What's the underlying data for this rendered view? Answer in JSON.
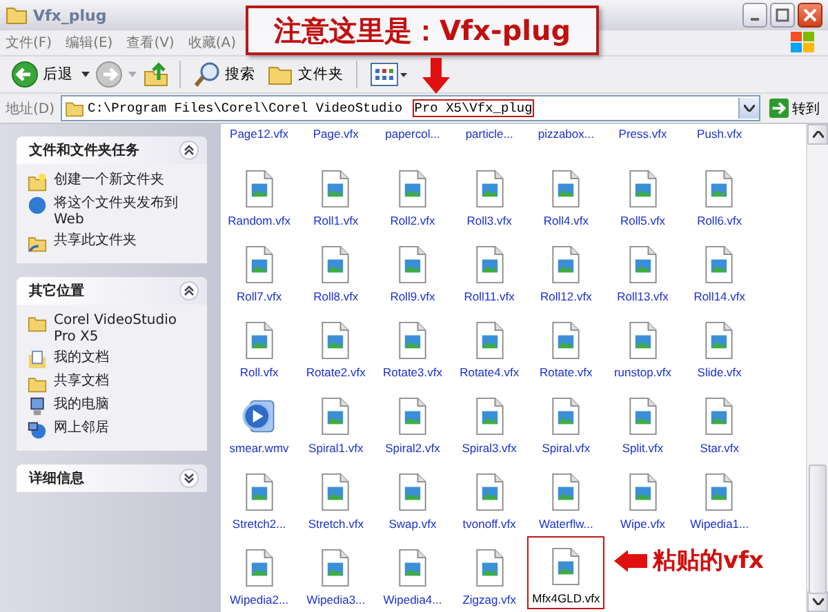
{
  "window": {
    "title": "Vfx_plug"
  },
  "menu": [
    "文件(F)",
    "编辑(E)",
    "查看(V)",
    "收藏(A)"
  ],
  "toolbar": {
    "back": "后退",
    "search": "搜索",
    "folders": "文件夹"
  },
  "address": {
    "label": "地址(D)",
    "path": "C:\\Program Files\\Corel\\Corel VideoStudio ",
    "path_marked": "Pro X5\\Vfx_plug",
    "go": "转到"
  },
  "sidebar": {
    "panels": [
      {
        "title": "文件和文件夹任务",
        "expanded": true,
        "items": [
          {
            "label": "创建一个新文件夹",
            "kind": "new-folder"
          },
          {
            "label": "将这个文件夹发布到 Web",
            "kind": "publish-web"
          },
          {
            "label": "共享此文件夹",
            "kind": "share-folder"
          }
        ]
      },
      {
        "title": "其它位置",
        "expanded": true,
        "items": [
          {
            "label": "Corel VideoStudio Pro X5",
            "kind": "folder"
          },
          {
            "label": "我的文档",
            "kind": "documents"
          },
          {
            "label": "共享文档",
            "kind": "folder"
          },
          {
            "label": "我的电脑",
            "kind": "computer"
          },
          {
            "label": "网上邻居",
            "kind": "network"
          }
        ]
      },
      {
        "title": "详细信息",
        "expanded": false
      }
    ]
  },
  "files": {
    "cut_row": [
      "Page12.vfx",
      "Page.vfx",
      "papercol...",
      "particle...",
      "pizzabox...",
      "Press.vfx",
      "Push.vfx"
    ],
    "items": [
      {
        "name": "Random.vfx",
        "kind": "vfx",
        "marked": false
      },
      {
        "name": "Roll1.vfx",
        "kind": "vfx",
        "marked": false
      },
      {
        "name": "Roll2.vfx",
        "kind": "vfx",
        "marked": false
      },
      {
        "name": "Roll3.vfx",
        "kind": "vfx",
        "marked": false
      },
      {
        "name": "Roll4.vfx",
        "kind": "vfx",
        "marked": false
      },
      {
        "name": "Roll5.vfx",
        "kind": "vfx",
        "marked": false
      },
      {
        "name": "Roll6.vfx",
        "kind": "vfx",
        "marked": false
      },
      {
        "name": "Roll7.vfx",
        "kind": "vfx",
        "marked": false
      },
      {
        "name": "Roll8.vfx",
        "kind": "vfx",
        "marked": false
      },
      {
        "name": "Roll9.vfx",
        "kind": "vfx",
        "marked": false
      },
      {
        "name": "Roll11.vfx",
        "kind": "vfx",
        "marked": false
      },
      {
        "name": "Roll12.vfx",
        "kind": "vfx",
        "marked": false
      },
      {
        "name": "Roll13.vfx",
        "kind": "vfx",
        "marked": false
      },
      {
        "name": "Roll14.vfx",
        "kind": "vfx",
        "marked": false
      },
      {
        "name": "Roll.vfx",
        "kind": "vfx",
        "marked": false
      },
      {
        "name": "Rotate2.vfx",
        "kind": "vfx",
        "marked": false
      },
      {
        "name": "Rotate3.vfx",
        "kind": "vfx",
        "marked": false
      },
      {
        "name": "Rotate4.vfx",
        "kind": "vfx",
        "marked": false
      },
      {
        "name": "Rotate.vfx",
        "kind": "vfx",
        "marked": false
      },
      {
        "name": "runstop.vfx",
        "kind": "vfx",
        "marked": false
      },
      {
        "name": "Slide.vfx",
        "kind": "vfx",
        "marked": false
      },
      {
        "name": "smear.wmv",
        "kind": "wmv",
        "marked": false
      },
      {
        "name": "Spiral1.vfx",
        "kind": "vfx",
        "marked": false
      },
      {
        "name": "Spiral2.vfx",
        "kind": "vfx",
        "marked": false
      },
      {
        "name": "Spiral3.vfx",
        "kind": "vfx",
        "marked": false
      },
      {
        "name": "Spiral.vfx",
        "kind": "vfx",
        "marked": false
      },
      {
        "name": "Split.vfx",
        "kind": "vfx",
        "marked": false
      },
      {
        "name": "Star.vfx",
        "kind": "vfx",
        "marked": false
      },
      {
        "name": "Stretch2...",
        "kind": "vfx",
        "marked": false
      },
      {
        "name": "Stretch.vfx",
        "kind": "vfx",
        "marked": false
      },
      {
        "name": "Swap.vfx",
        "kind": "vfx",
        "marked": false
      },
      {
        "name": "tvonoff.vfx",
        "kind": "vfx",
        "marked": false
      },
      {
        "name": "Waterflw...",
        "kind": "vfx",
        "marked": false
      },
      {
        "name": "Wipe.vfx",
        "kind": "vfx",
        "marked": false
      },
      {
        "name": "Wipedia1...",
        "kind": "vfx",
        "marked": false
      },
      {
        "name": "Wipedia2...",
        "kind": "vfx",
        "marked": false
      },
      {
        "name": "Wipedia3...",
        "kind": "vfx",
        "marked": false
      },
      {
        "name": "Wipedia4...",
        "kind": "vfx",
        "marked": false
      },
      {
        "name": "Zigzag.vfx",
        "kind": "vfx",
        "marked": false
      },
      {
        "name": "Mfx4GLD.vfx",
        "kind": "vfx",
        "marked": true
      }
    ]
  },
  "annotations": {
    "callout": "注意这里是：Vfx-plug",
    "paste_note": "粘贴的vfx"
  }
}
